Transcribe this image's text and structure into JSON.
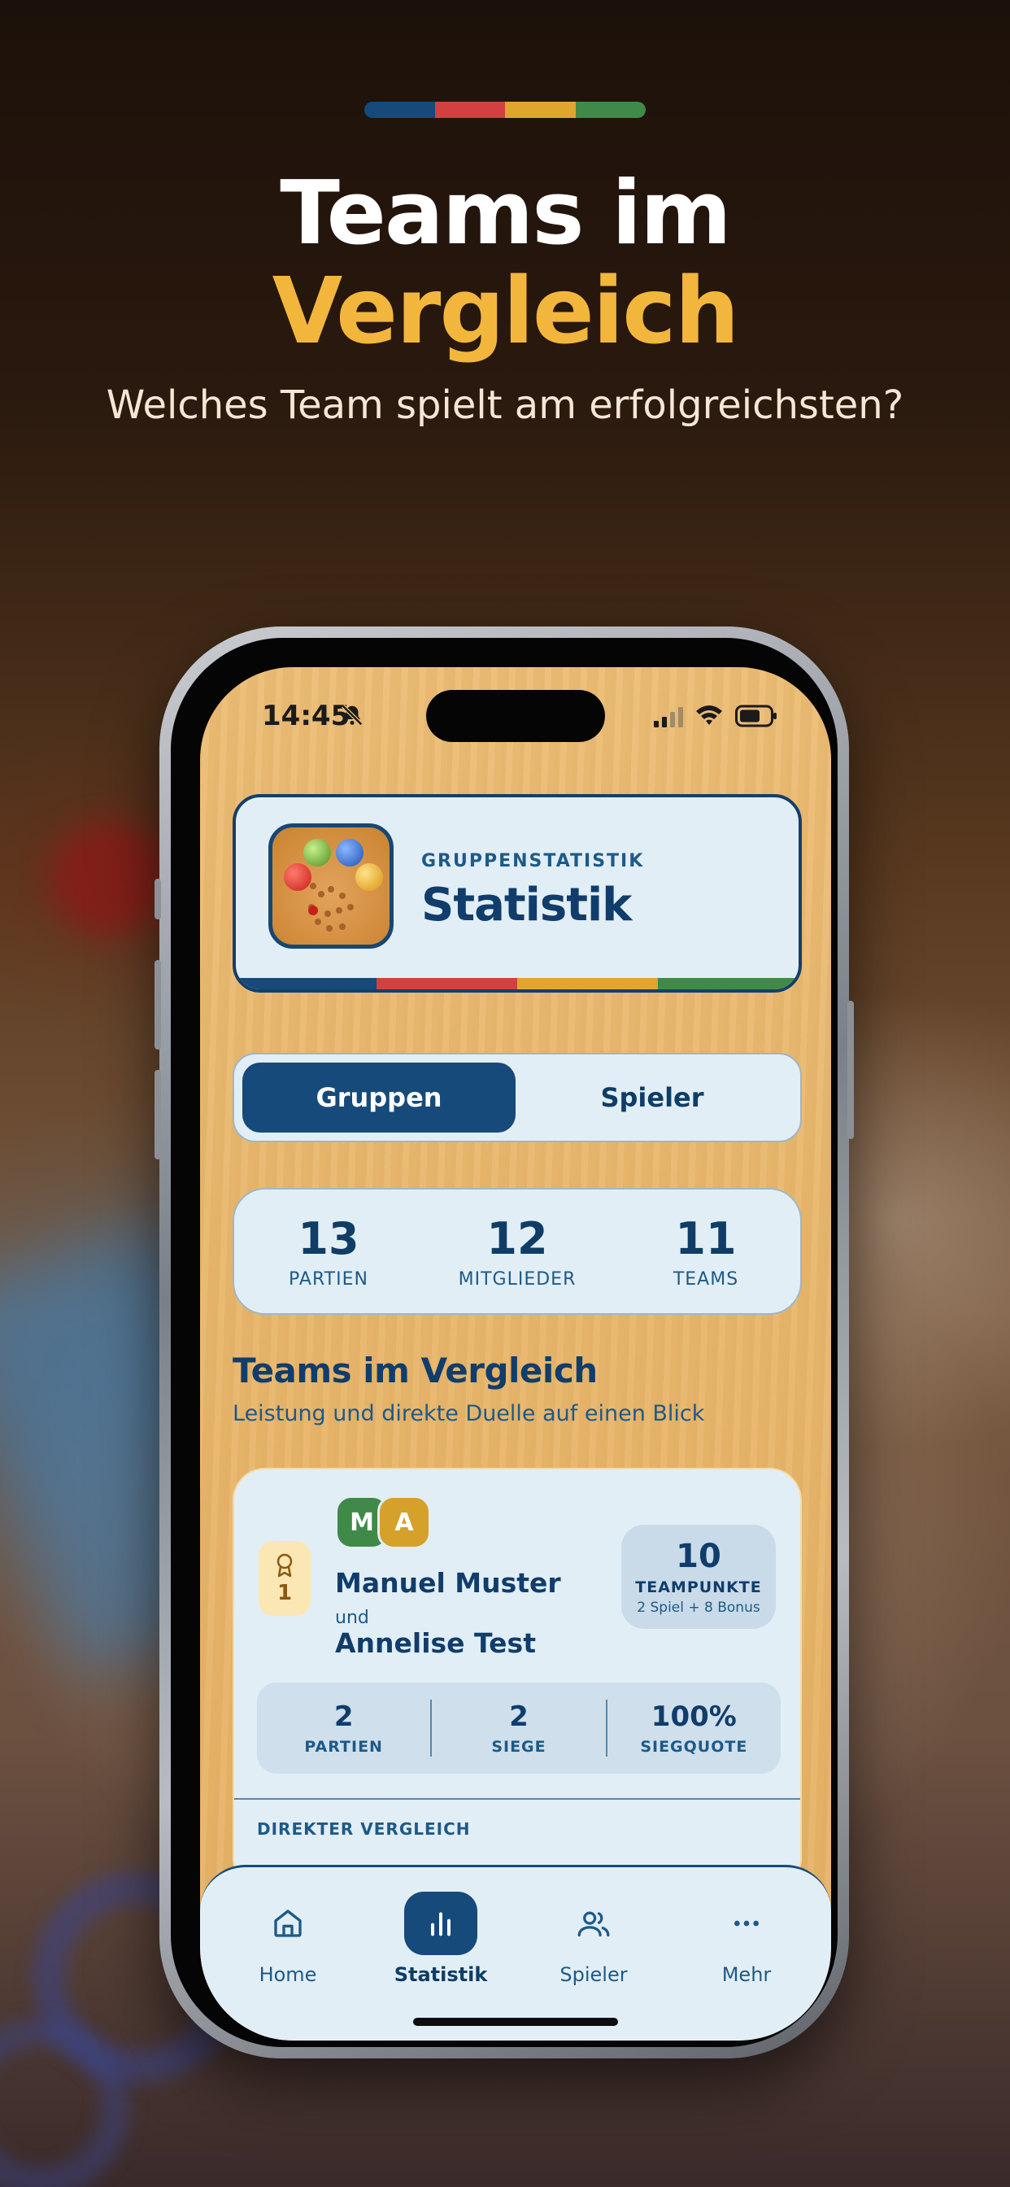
{
  "hero": {
    "title_line1": "Teams im",
    "title_line2": "Vergleich",
    "subtitle": "Welches Team spielt am erfolgreichsten?",
    "stripe_colors": [
      "#154a7a",
      "#d24040",
      "#e0a52c",
      "#3f8a48"
    ]
  },
  "status_bar": {
    "time": "14:45"
  },
  "header": {
    "overline": "GRUPPENSTATISTIK",
    "title": "Statistik"
  },
  "segment": {
    "active": "Gruppen",
    "inactive": "Spieler"
  },
  "stats": [
    {
      "value": "13",
      "label": "PARTIEN"
    },
    {
      "value": "12",
      "label": "MITGLIEDER"
    },
    {
      "value": "11",
      "label": "TEAMS"
    }
  ],
  "section": {
    "title": "Teams im Vergleich",
    "subtitle": "Leistung und direkte Duelle auf einen Blick"
  },
  "team": {
    "rank": "1",
    "avatar1": "M",
    "avatar2": "A",
    "avatar1_color": "#3f8a48",
    "avatar2_color": "#d6a12a",
    "player1": "Manuel Muster",
    "connector": "und",
    "player2": "Annelise Test",
    "points": "10",
    "points_label": "TEAMPUNKTE",
    "points_detail": "2 Spiel + 8 Bonus",
    "mini_stats": [
      {
        "value": "2",
        "label": "PARTIEN"
      },
      {
        "value": "2",
        "label": "SIEGE"
      },
      {
        "value": "100%",
        "label": "SIEGQUOTE"
      }
    ],
    "direct_label": "DIREKTER VERGLEICH"
  },
  "tabbar": {
    "home": "Home",
    "stats": "Statistik",
    "players": "Spieler",
    "more": "Mehr"
  }
}
